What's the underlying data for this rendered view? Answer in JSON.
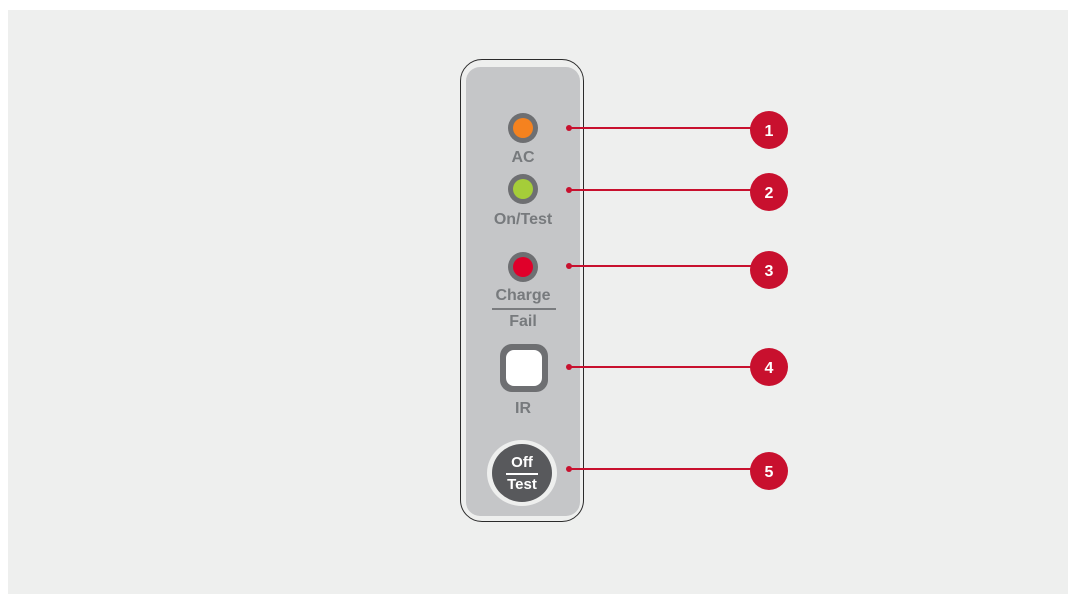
{
  "panel": {
    "leds": [
      {
        "id": "ac",
        "label": "AC",
        "color": "#f5821f"
      },
      {
        "id": "on-test",
        "label": "On/Test",
        "color": "#a5cd39"
      },
      {
        "id": "charge-fail",
        "label_top": "Charge",
        "label_bottom": "Fail",
        "color": "#e0002a"
      }
    ],
    "ir": {
      "label": "IR"
    },
    "off_test_button": {
      "top": "Off",
      "bottom": "Test"
    }
  },
  "callouts": [
    "1",
    "2",
    "3",
    "4",
    "5"
  ],
  "colors": {
    "accent": "#c8102e",
    "panel": "#c5c6c8",
    "background": "#eeefee"
  }
}
